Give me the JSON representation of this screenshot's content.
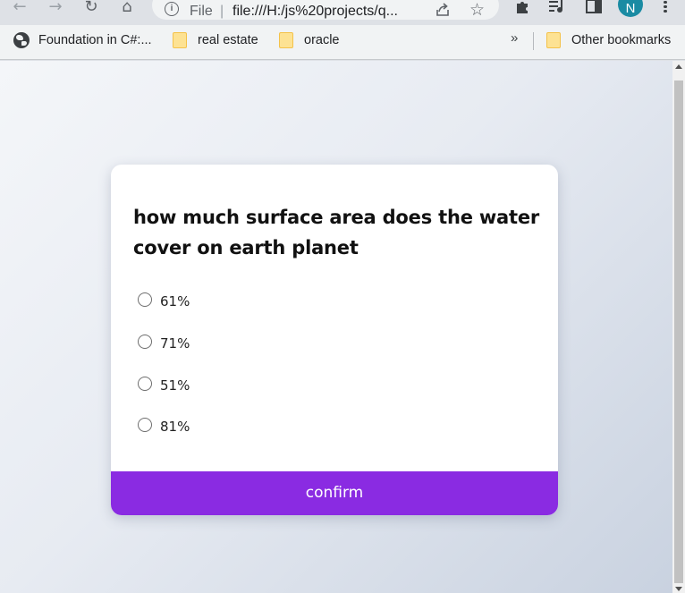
{
  "browser": {
    "url_chip": "File",
    "url": "file:///H:/js%20projects/q...",
    "avatar_initial": "N"
  },
  "bookmarks": {
    "items": [
      {
        "label": "Foundation in C#:...",
        "icon": "globe-icon"
      },
      {
        "label": "real estate",
        "icon": "folder-icon"
      },
      {
        "label": "oracle",
        "icon": "folder-icon"
      }
    ],
    "overflow_label": "»",
    "other": {
      "label": "Other bookmarks",
      "icon": "folder-icon"
    }
  },
  "quiz": {
    "question": "how much surface area does the water cover on earth planet",
    "answers": [
      "61%",
      "71%",
      "51%",
      "81%"
    ],
    "confirm_label": "confirm",
    "accent_color": "#8a2be2"
  }
}
